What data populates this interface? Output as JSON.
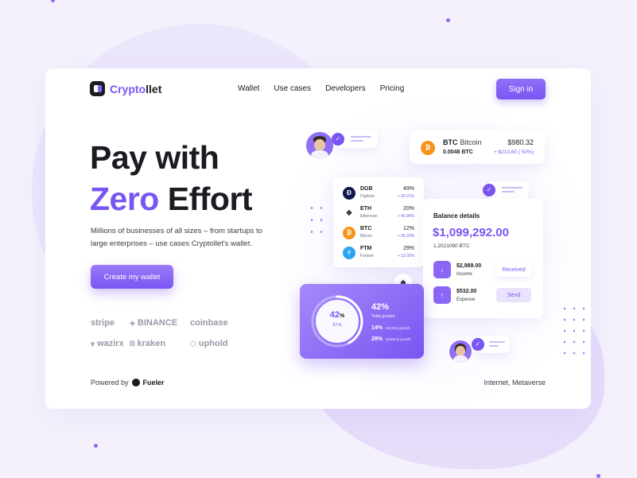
{
  "brand": {
    "name_a": "Crypto",
    "name_b": "llet",
    "accent": "#7a55f2"
  },
  "nav": {
    "items": [
      "Wallet",
      "Use cases",
      "Developers",
      "Pricing"
    ],
    "signin_label": "Sign in"
  },
  "hero": {
    "title_line1": "Pay with",
    "title_accent": "Zero",
    "title_rest": " Effort",
    "description": "Millions of businesses of all sizes – from startups to large enterprises – use cases Cryptollet's wallet.",
    "cta_label": "Create my wallet"
  },
  "partners": [
    "stripe",
    "BINANCE",
    "coinbase",
    "wazirx",
    "kraken",
    "uphold"
  ],
  "footer": {
    "powered_label": "Powered by",
    "powered_brand": "Fueler",
    "tags": "Internet, Metaverse"
  },
  "btc_card": {
    "symbol": "BTC",
    "name": "Bitcoin",
    "amount": "0.0048 BTC",
    "price": "$980.32",
    "change": "+ $210.80 ( 50%)"
  },
  "coins": [
    {
      "symbol": "DGB",
      "name": "Digibyte",
      "pct": "49%",
      "change": "+ 20.21%",
      "icon": "digibyte-icon",
      "color": "#0d1a4a"
    },
    {
      "symbol": "ETH",
      "name": "Ethereum",
      "pct": "20%",
      "change": "+ 40.99%",
      "icon": "ethereum-icon",
      "color": "#ffffff"
    },
    {
      "symbol": "BTC",
      "name": "Bitcoin",
      "pct": "12%",
      "change": "+ 06.20%",
      "icon": "bitcoin-icon",
      "color": "#f7931a"
    },
    {
      "symbol": "FTM",
      "name": "Fantom",
      "pct": "29%",
      "change": "+ 13.02%",
      "icon": "fantom-icon",
      "color": "#2aa5f1"
    }
  ],
  "balance": {
    "title": "Balance details",
    "value": "$1,099,292.00",
    "sub": "1.2021090 BTC",
    "income_amount": "$2,989.00",
    "income_label": "Income",
    "expense_amount": "$532.00",
    "expense_label": "Expense",
    "received_label": "Received",
    "send_label": "Send"
  },
  "growth": {
    "ring_value": "42",
    "ring_unit": "%",
    "ring_symbol": "ETH",
    "ring_fraction": 0.42,
    "value": "42%",
    "label": "Total growth",
    "rows": [
      {
        "value": "14%",
        "label": "Monthly growth"
      },
      {
        "value": "28%",
        "label": "Quaterly growth"
      }
    ]
  }
}
